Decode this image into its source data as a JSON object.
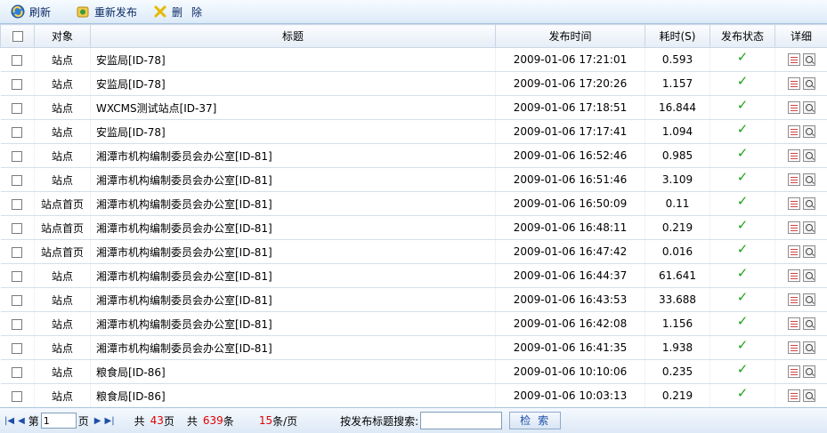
{
  "toolbar": {
    "refresh_label": "刷新",
    "republish_label": "重新发布",
    "delete_label": "删除"
  },
  "table": {
    "headers": [
      "对象",
      "标题",
      "发布时间",
      "耗时(S)",
      "发布状态",
      "详细"
    ],
    "rows": [
      {
        "object": "站点",
        "title": "安监局[ID-78]",
        "time": "2009-01-06 17:21:01",
        "duration": "0.593"
      },
      {
        "object": "站点",
        "title": "安监局[ID-78]",
        "time": "2009-01-06 17:20:26",
        "duration": "1.157"
      },
      {
        "object": "站点",
        "title": "WXCMS测试站点[ID-37]",
        "time": "2009-01-06 17:18:51",
        "duration": "16.844"
      },
      {
        "object": "站点",
        "title": "安监局[ID-78]",
        "time": "2009-01-06 17:17:41",
        "duration": "1.094"
      },
      {
        "object": "站点",
        "title": "湘潭市机构编制委员会办公室[ID-81]",
        "time": "2009-01-06 16:52:46",
        "duration": "0.985"
      },
      {
        "object": "站点",
        "title": "湘潭市机构编制委员会办公室[ID-81]",
        "time": "2009-01-06 16:51:46",
        "duration": "3.109"
      },
      {
        "object": "站点首页",
        "title": "湘潭市机构编制委员会办公室[ID-81]",
        "time": "2009-01-06 16:50:09",
        "duration": "0.11"
      },
      {
        "object": "站点首页",
        "title": "湘潭市机构编制委员会办公室[ID-81]",
        "time": "2009-01-06 16:48:11",
        "duration": "0.219"
      },
      {
        "object": "站点首页",
        "title": "湘潭市机构编制委员会办公室[ID-81]",
        "time": "2009-01-06 16:47:42",
        "duration": "0.016"
      },
      {
        "object": "站点",
        "title": "湘潭市机构编制委员会办公室[ID-81]",
        "time": "2009-01-06 16:44:37",
        "duration": "61.641"
      },
      {
        "object": "站点",
        "title": "湘潭市机构编制委员会办公室[ID-81]",
        "time": "2009-01-06 16:43:53",
        "duration": "33.688"
      },
      {
        "object": "站点",
        "title": "湘潭市机构编制委员会办公室[ID-81]",
        "time": "2009-01-06 16:42:08",
        "duration": "1.156"
      },
      {
        "object": "站点",
        "title": "湘潭市机构编制委员会办公室[ID-81]",
        "time": "2009-01-06 16:41:35",
        "duration": "1.938"
      },
      {
        "object": "站点",
        "title": "粮食局[ID-86]",
        "time": "2009-01-06 10:10:06",
        "duration": "0.235"
      },
      {
        "object": "站点",
        "title": "粮食局[ID-86]",
        "time": "2009-01-06 10:03:13",
        "duration": "0.219"
      }
    ]
  },
  "pager": {
    "page_prefix": "第",
    "current_page": "1",
    "page_suffix": "页",
    "total_prefix": "共",
    "total_pages": "43",
    "total_pages_unit": "页",
    "total_records_prefix": "共",
    "total_records": "639",
    "total_records_unit": "条",
    "page_size": "15",
    "page_size_unit": "条/页",
    "search_label": "按发布标题搜索:",
    "search_value": "",
    "search_button": "检索"
  },
  "colors": {
    "status_ok": "#1aa51a",
    "pager_highlight": "#e00000"
  },
  "icons": {
    "refresh": "refresh-icon",
    "republish": "republish-icon",
    "delete": "delete-icon",
    "status": "checkmark-icon",
    "detail_list": "detail-list-icon",
    "detail_view": "magnifier-icon"
  }
}
